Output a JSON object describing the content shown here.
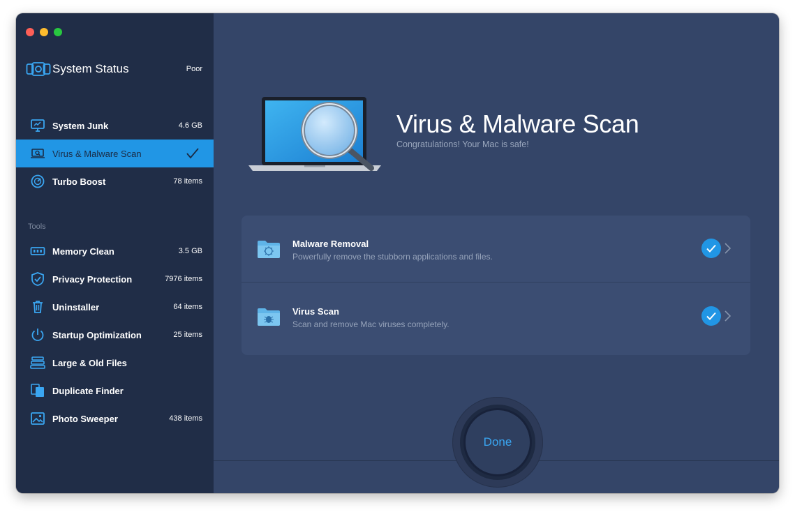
{
  "sidebar": {
    "status": {
      "title": "System Status",
      "value": "Poor"
    },
    "scan_items": [
      {
        "label": "System Junk",
        "meta": "4.6 GB",
        "icon": "monitor-icon"
      },
      {
        "label": "Virus & Malware Scan",
        "meta": "",
        "icon": "laptop-scan-icon",
        "active": true
      },
      {
        "label": "Turbo Boost",
        "meta": "78 items",
        "icon": "speedometer-icon"
      }
    ],
    "tools_label": "Tools",
    "tools": [
      {
        "label": "Memory Clean",
        "meta": "3.5 GB",
        "icon": "memory-chip-icon"
      },
      {
        "label": "Privacy Protection",
        "meta": "7976 items",
        "icon": "shield-icon"
      },
      {
        "label": "Uninstaller",
        "meta": "64 items",
        "icon": "trash-icon"
      },
      {
        "label": "Startup Optimization",
        "meta": "25 items",
        "icon": "power-icon"
      },
      {
        "label": "Large & Old Files",
        "meta": "",
        "icon": "stack-icon"
      },
      {
        "label": "Duplicate Finder",
        "meta": "",
        "icon": "duplicate-icon"
      },
      {
        "label": "Photo Sweeper",
        "meta": "438 items",
        "icon": "photo-icon"
      }
    ]
  },
  "main": {
    "title": "Virus & Malware Scan",
    "subtitle": "Congratulations! Your Mac is safe!",
    "results": [
      {
        "title": "Malware Removal",
        "desc": "Powerfully remove the stubborn applications and files.",
        "icon": "folder-virus-icon"
      },
      {
        "title": "Virus Scan",
        "desc": "Scan and remove Mac viruses completely.",
        "icon": "folder-bug-icon"
      }
    ],
    "done_label": "Done"
  },
  "colors": {
    "accent": "#2196e5",
    "sidebar_bg": "#202d47",
    "main_bg": "#344568"
  }
}
